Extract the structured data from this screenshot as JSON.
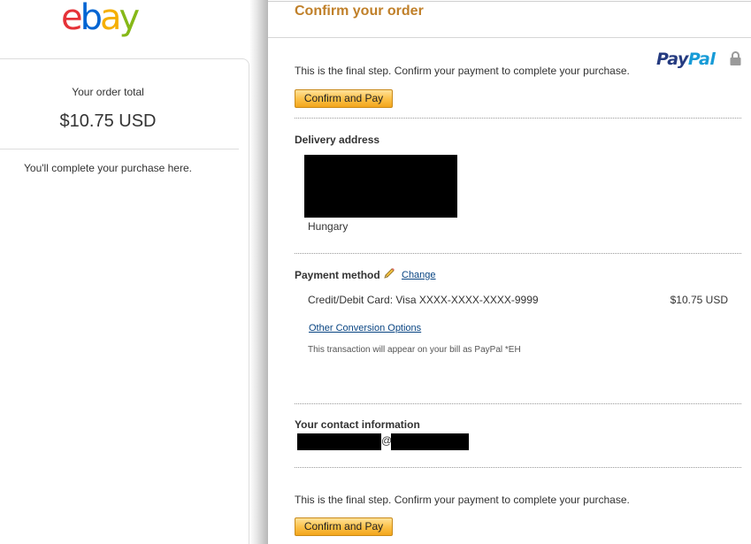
{
  "left": {
    "logo": {
      "e": "e",
      "b": "b",
      "a": "a",
      "y": "y"
    },
    "order_total_label": "Your order total",
    "order_total_amount": "$10.75 USD",
    "complete_note": "You'll complete your purchase here."
  },
  "main": {
    "title": "Confirm your order",
    "paypal_logo": {
      "pay": "Pay",
      "pal": "Pal"
    },
    "final_step_text": "This is the final step. Confirm your payment to complete your purchase.",
    "confirm_button_label": "Confirm and Pay",
    "delivery": {
      "heading": "Delivery address",
      "country": "Hungary"
    },
    "payment": {
      "heading": "Payment method",
      "change_link": "Change",
      "card_line": "Credit/Debit Card: Visa XXXX-XXXX-XXXX-9999",
      "amount": "$10.75 USD",
      "conversion_link": "Other Conversion Options",
      "bill_note": "This transaction will appear on your bill as PayPal *EH"
    },
    "contact": {
      "heading": "Your contact information",
      "at": "@"
    }
  },
  "colors": {
    "title": "#c0802a",
    "link": "#084482",
    "button_top": "#ffe29a",
    "button_bottom": "#f3a51c",
    "paypal_dark": "#253b80",
    "paypal_light": "#179bd7"
  }
}
